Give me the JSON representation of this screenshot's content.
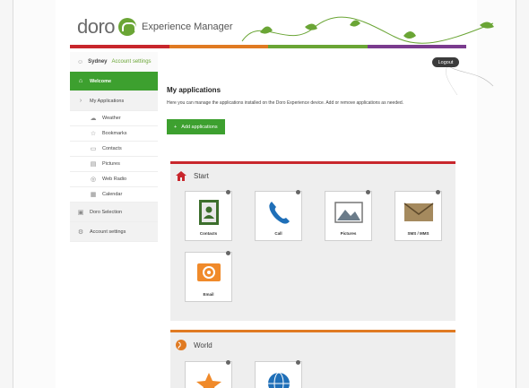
{
  "header": {
    "brand": "doro",
    "product": "Experience Manager",
    "accent_colors": [
      "#c8262c",
      "#e07a22",
      "#6aa535",
      "#7a3b8e"
    ]
  },
  "user": {
    "name": "Sydney",
    "link": "Account settings",
    "logout_label": "Logout"
  },
  "sidebar": {
    "items": [
      {
        "label": "Welcome",
        "icon": "home-icon",
        "active": true
      },
      {
        "label": "My Applications",
        "icon": "chevron-right-icon",
        "active": false
      },
      {
        "label": "Weather",
        "icon": "weather-icon",
        "sub": true
      },
      {
        "label": "Bookmarks",
        "icon": "star-icon",
        "sub": true
      },
      {
        "label": "Contacts",
        "icon": "contacts-icon",
        "sub": true
      },
      {
        "label": "Pictures",
        "icon": "picture-icon",
        "sub": true
      },
      {
        "label": "Web Radio",
        "icon": "radio-icon",
        "sub": true
      },
      {
        "label": "Calendar",
        "icon": "calendar-icon",
        "sub": true
      },
      {
        "label": "Doro Selection",
        "icon": "box-icon",
        "active": false
      },
      {
        "label": "Account settings",
        "icon": "settings-icon",
        "active": false
      }
    ]
  },
  "main": {
    "title": "My applications",
    "description": "Here you can manage the applications installed on the Doro Experience device. Add or remove applications as needed.",
    "add_button": "Add applications"
  },
  "sections": [
    {
      "title": "Start",
      "color": "#c8262c",
      "tiles": [
        {
          "label": "Contacts",
          "icon": "contacts-book-icon"
        },
        {
          "label": "Call",
          "icon": "phone-icon"
        },
        {
          "label": "Pictures",
          "icon": "picture-icon"
        },
        {
          "label": "SMS / MMS",
          "icon": "envelope-icon"
        },
        {
          "label": "Email",
          "icon": "email-icon"
        }
      ]
    },
    {
      "title": "World",
      "color": "#e07a22",
      "tiles": [
        {
          "label": "",
          "icon": "star-icon"
        },
        {
          "label": "",
          "icon": "globe-icon"
        }
      ]
    }
  ]
}
